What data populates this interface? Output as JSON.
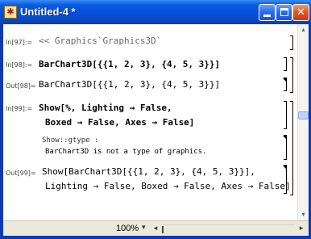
{
  "window": {
    "title": "Untitled-4 *",
    "app_icon_glyph": "✱",
    "buttons": {
      "minimize": "minimize-button",
      "maximize": "maximize-button",
      "close": "✕"
    }
  },
  "notebook": {
    "cells": [
      {
        "label": "In[97]:=",
        "text": "<< Graphics`Graphics3D`"
      },
      {
        "label": "In[98]:=",
        "text": "BarChart3D[{{1, 2, 3}, {4, 5, 3}}]"
      },
      {
        "label": "Out[98]=",
        "text": "BarChart3D[{{1, 2, 3}, {4, 5, 3}}]"
      },
      {
        "label": "In[99]:=",
        "lines": [
          "Show[%, Lighting → False,",
          "Boxed → False, Axes → False]"
        ]
      },
      {
        "message_head": "Show::gtype :",
        "message_body": "BarChart3D is not a type of graphics."
      },
      {
        "label": "Out[99]=",
        "lines": [
          "Show[BarChart3D[{{1, 2, 3}, {4, 5, 3}}],",
          "Lighting → False, Boxed → False, Axes → False]"
        ]
      }
    ]
  },
  "statusbar": {
    "zoom": "100%",
    "zoom_arrow": "▾",
    "scroll_left": "◂",
    "scroll_right": "▸"
  },
  "vscroll": {
    "up": "▴",
    "down": "▾"
  }
}
